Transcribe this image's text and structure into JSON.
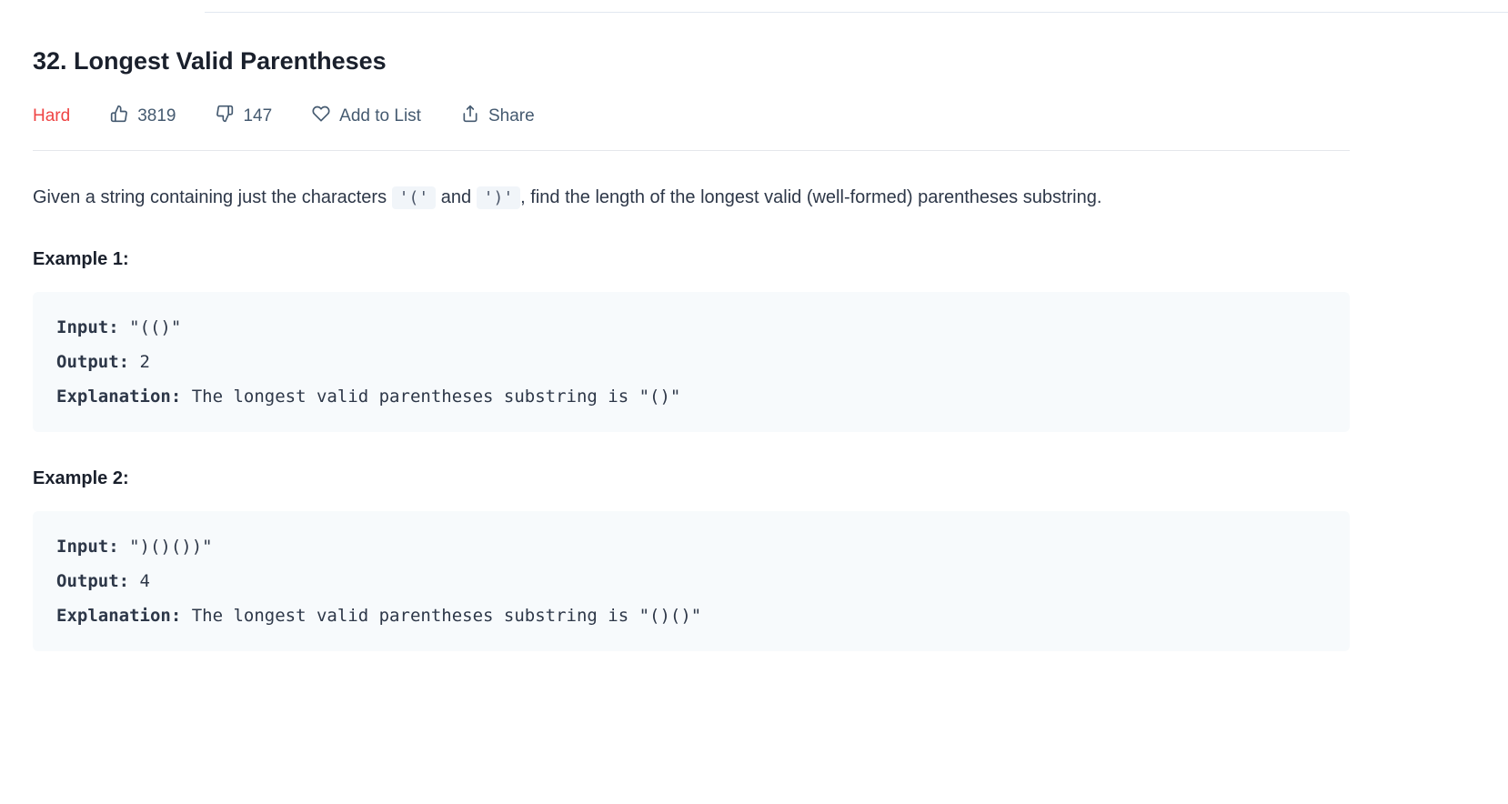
{
  "problem": {
    "title": "32. Longest Valid Parentheses",
    "difficulty": "Hard",
    "likes": "3819",
    "dislikes": "147",
    "add_to_list_label": "Add to List",
    "share_label": "Share"
  },
  "description": {
    "part1": "Given a string containing just the characters ",
    "code1": "'('",
    "part2": " and ",
    "code2": "')'",
    "part3": ", find the length of the longest valid (well-formed) parentheses substring."
  },
  "examples": [
    {
      "label": "Example 1:",
      "input_key": "Input:",
      "input_val": " \"(()\"",
      "output_key": "Output:",
      "output_val": " 2",
      "explanation_key": "Explanation:",
      "explanation_val": " The longest valid parentheses substring is \"()\""
    },
    {
      "label": "Example 2:",
      "input_key": "Input:",
      "input_val": " \")()())\"",
      "output_key": "Output:",
      "output_val": " 4",
      "explanation_key": "Explanation:",
      "explanation_val": " The longest valid parentheses substring is \"()()\""
    }
  ]
}
